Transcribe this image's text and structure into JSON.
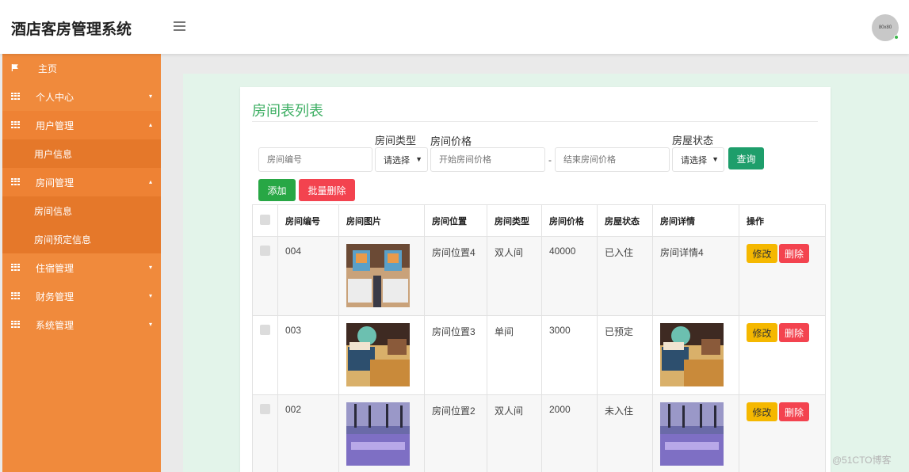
{
  "app": {
    "title": "酒店客房管理系统",
    "avatar_text": "80x80"
  },
  "sidebar": {
    "items": [
      {
        "label": "主页",
        "icon": "flag-icon"
      },
      {
        "label": "个人中心",
        "icon": "grid-icon"
      },
      {
        "label": "用户管理",
        "icon": "grid-icon",
        "expanded": true
      },
      {
        "label": "用户信息",
        "sub": true
      },
      {
        "label": "房间管理",
        "icon": "grid-icon",
        "expanded": true
      },
      {
        "label": "房间信息",
        "sub": true
      },
      {
        "label": "房间预定信息",
        "sub": true
      },
      {
        "label": "住宿管理",
        "icon": "grid-icon"
      },
      {
        "label": "财务管理",
        "icon": "grid-icon"
      },
      {
        "label": "系统管理",
        "icon": "grid-icon"
      }
    ]
  },
  "page": {
    "title": "房间表列表",
    "filters": {
      "room_no_placeholder": "房间编号",
      "type_label": "房间类型",
      "type_selected": "请选择",
      "price_label": "房间价格",
      "price_start_placeholder": "开始房间价格",
      "price_separator": "-",
      "price_end_placeholder": "结束房间价格",
      "status_label": "房屋状态",
      "status_selected": "请选择",
      "query_button": "查询"
    },
    "actions": {
      "add": "添加",
      "batch_delete": "批量删除"
    },
    "table": {
      "headers": [
        "房间编号",
        "房间图片",
        "房间位置",
        "房间类型",
        "房间价格",
        "房屋状态",
        "房间详情",
        "操作"
      ],
      "edit_label": "修改",
      "delete_label": "删除",
      "rows": [
        {
          "no": "004",
          "location": "房间位置4",
          "type": "双人间",
          "price": "40000",
          "status": "已入住",
          "detail": "房间详情4",
          "detail_is_image": false
        },
        {
          "no": "003",
          "location": "房间位置3",
          "type": "单间",
          "price": "3000",
          "status": "已预定",
          "detail": "",
          "detail_is_image": true
        },
        {
          "no": "002",
          "location": "房间位置2",
          "type": "双人间",
          "price": "2000",
          "status": "未入住",
          "detail": "",
          "detail_is_image": true
        }
      ]
    }
  },
  "watermark": "@51CTO博客",
  "colors": {
    "sidebar": "#f08a3c",
    "accent_green": "#3cae62",
    "query": "#1e9e6b",
    "add": "#28a745",
    "danger": "#f3434f",
    "warning": "#f5b800"
  }
}
